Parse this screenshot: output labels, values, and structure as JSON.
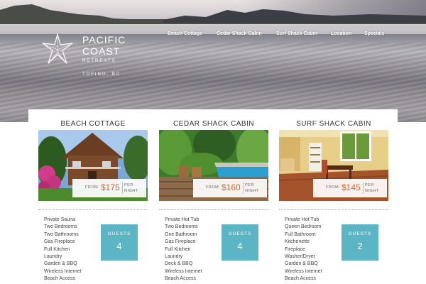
{
  "logo": {
    "line1": "PACIFIC",
    "line2": "COAST",
    "line3": "RETREATS",
    "location": "TOFINO, BC"
  },
  "nav": [
    {
      "label": "Beach Cottage"
    },
    {
      "label": "Cedar Shack Cabin"
    },
    {
      "label": "Surf Shack Cabin"
    },
    {
      "label": "Location"
    },
    {
      "label": "Specials"
    }
  ],
  "cabins": [
    {
      "title": "BEACH COTTAGE",
      "from": "FROM",
      "price": "$175",
      "per": "PER",
      "night": "NIGHT",
      "features": [
        "Private Sauna",
        "Two Bedrooms",
        "Two Bathrooms",
        "Gas Fireplace",
        "Full Kitchen",
        "Laundry",
        "Garden & BBQ",
        "Wireless Internet",
        "Beach Access"
      ],
      "guests_label": "GUESTS",
      "guests": "4"
    },
    {
      "title": "CEDAR SHACK CABIN",
      "from": "FROM",
      "price": "$160",
      "per": "PER",
      "night": "NIGHT",
      "features": [
        "Private Hot Tub",
        "Two Bedrooms",
        "One Bathroom",
        "Gas Fireplace",
        "Full Kitchen",
        "Laundry",
        "Deck & BBQ",
        "Wireless Internet",
        "Beach Access"
      ],
      "guests_label": "GUESTS",
      "guests": "4"
    },
    {
      "title": "SURF SHACK CABIN",
      "from": "FROM",
      "price": "$145",
      "per": "PER",
      "night": "NIGHT",
      "features": [
        "Private Hot Tub",
        "Queen Bedroom",
        "Full Bathroom",
        "Kitchenette",
        "Fireplace",
        "Washer/Dryer",
        "Garden & BBQ",
        "Wireless Internet",
        "Beach Access"
      ],
      "guests_label": "GUESTS",
      "guests": "2"
    }
  ],
  "colors": {
    "accent_price": "#d9642f",
    "guests_box": "#5bb5c4"
  }
}
